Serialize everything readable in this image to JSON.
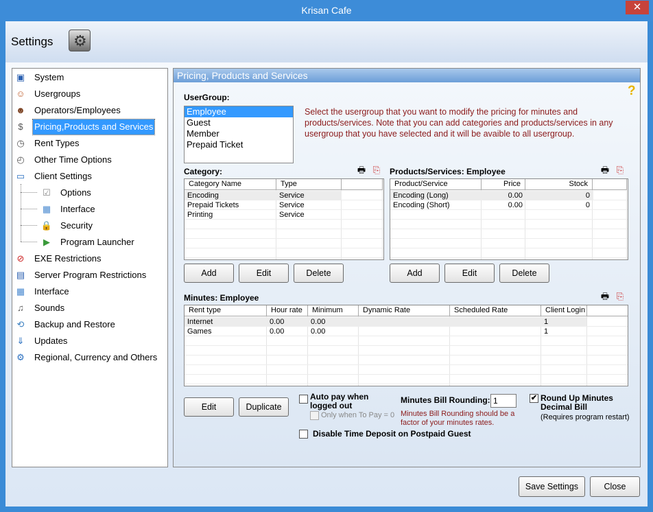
{
  "window": {
    "title": "Krisan Cafe",
    "close_glyph": "✕"
  },
  "header": {
    "title": "Settings",
    "icon": "settings-gear-icon"
  },
  "nav": {
    "items": [
      {
        "label": "System",
        "icon": "computer-icon",
        "color": "#2a5fb0",
        "glyph": "▣"
      },
      {
        "label": "Usergroups",
        "icon": "users-icon",
        "color": "#c06030",
        "glyph": "☺"
      },
      {
        "label": "Operators/Employees",
        "icon": "user-icon",
        "color": "#7a4020",
        "glyph": "☻"
      },
      {
        "label": "Pricing,Products and Services",
        "icon": "cash-register-icon",
        "color": "#555",
        "glyph": "$"
      },
      {
        "label": "Rent Types",
        "icon": "clock-play-icon",
        "color": "#555",
        "glyph": "◷"
      },
      {
        "label": "Other Time Options",
        "icon": "clock-icon",
        "color": "#555",
        "glyph": "◴"
      },
      {
        "label": "Client Settings",
        "icon": "monitor-icon",
        "color": "#2a6fc0",
        "glyph": "▭"
      },
      {
        "label": "Options",
        "icon": "checklist-icon",
        "color": "#888",
        "glyph": "☑"
      },
      {
        "label": "Interface",
        "icon": "window-icon",
        "color": "#4a8ad0",
        "glyph": "▦"
      },
      {
        "label": "Security",
        "icon": "lock-icon",
        "color": "#3a6fd0",
        "glyph": "🔒"
      },
      {
        "label": "Program Launcher",
        "icon": "launcher-icon",
        "color": "#3a9a3a",
        "glyph": "▶"
      },
      {
        "label": "EXE Restrictions",
        "icon": "no-entry-icon",
        "color": "#cc2222",
        "glyph": "⊘"
      },
      {
        "label": "Server Program Restrictions",
        "icon": "server-icon",
        "color": "#2a5fb0",
        "glyph": "▤"
      },
      {
        "label": "Interface",
        "icon": "window-icon",
        "color": "#4a8ad0",
        "glyph": "▦"
      },
      {
        "label": "Sounds",
        "icon": "speaker-icon",
        "color": "#555",
        "glyph": "♫"
      },
      {
        "label": "Backup and Restore",
        "icon": "backup-icon",
        "color": "#3a7fc0",
        "glyph": "⟲"
      },
      {
        "label": "Updates",
        "icon": "updates-icon",
        "color": "#2a6fc0",
        "glyph": "⇓"
      },
      {
        "label": "Regional, Currency and Others",
        "icon": "regional-gear-icon",
        "color": "#2a6fc0",
        "glyph": "⚙"
      }
    ],
    "selected": "Pricing,Products and Services"
  },
  "panel": {
    "title": "Pricing, Products and Services",
    "help_icon": "help-icon",
    "usergroup_label": "UserGroup:",
    "usergroups": [
      "Employee",
      "Guest",
      "Member",
      "Prepaid Ticket"
    ],
    "selected_usergroup": "Employee",
    "note": "Select the usergroup that you want to modify  the pricing for minutes and products/services. Note that you can add categories and products/services in any usergroup that you have selected and it will be avaible to all usergroup.",
    "category": {
      "label": "Category:",
      "headers": [
        "Category Name",
        "Type"
      ],
      "rows": [
        [
          "Encoding",
          "Service"
        ],
        [
          "Prepaid Tickets",
          "Service"
        ],
        [
          "Printing",
          "Service"
        ]
      ],
      "buttons": [
        "Add",
        "Edit",
        "Delete"
      ]
    },
    "products": {
      "label": "Products/Services: Employee",
      "headers": [
        "Product/Service",
        "Price",
        "Stock"
      ],
      "rows": [
        [
          "Encoding (Long)",
          "0.00",
          "0"
        ],
        [
          "Encoding (Short)",
          "0.00",
          "0"
        ]
      ],
      "buttons": [
        "Add",
        "Edit",
        "Delete"
      ]
    },
    "minutes": {
      "label": "Minutes: Employee",
      "headers": [
        "Rent type",
        "Hour rate",
        "Minimum",
        "Dynamic Rate",
        "Scheduled Rate",
        "Client Login"
      ],
      "rows": [
        [
          "Internet",
          "0.00",
          "0.00",
          "",
          "",
          "1"
        ],
        [
          "Games",
          "0.00",
          "0.00",
          "",
          "",
          "1"
        ]
      ],
      "buttons": [
        "Edit",
        "Duplicate"
      ]
    },
    "autopay": {
      "label": "Auto pay when logged out",
      "checked": false,
      "sub_label": "Only when To Pay = 0",
      "sub_checked": false
    },
    "disable_deposit": {
      "label": "Disable Time Deposit on Postpaid Guest",
      "checked": false
    },
    "rounding": {
      "label": "Minutes Bill Rounding:",
      "value": "1",
      "note": "Minutes Bill Rounding should be a factor of your minutes rates."
    },
    "roundup": {
      "label": "Round Up Minutes Decimal Bill",
      "checked": true,
      "check_glyph": "✔",
      "note": "(Requires program restart)"
    }
  },
  "footer": {
    "save": "Save Settings",
    "close": "Close"
  }
}
